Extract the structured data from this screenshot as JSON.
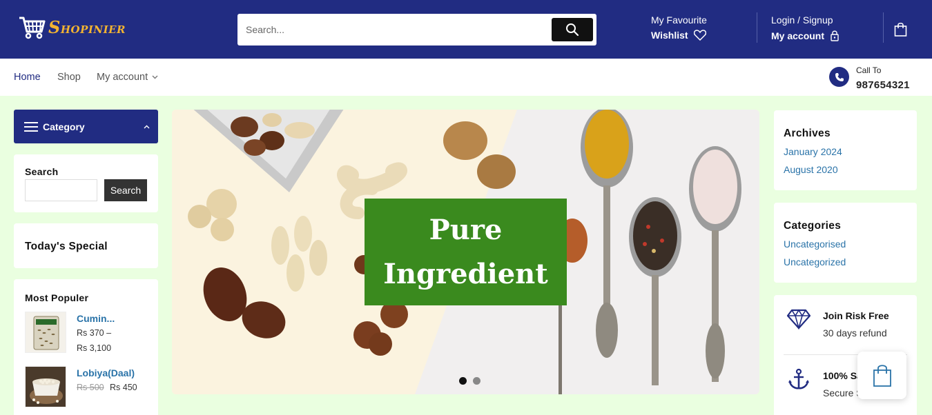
{
  "header": {
    "brand": "SHOPINIER",
    "search_placeholder": "Search...",
    "favourite_small": "My Favourite",
    "favourite_bold": "Wishlist",
    "login_small": "Login / Signup",
    "login_bold": "My account"
  },
  "nav": {
    "items": [
      "Home",
      "Shop",
      "My account"
    ],
    "call_label": "Call To",
    "call_number": "987654321"
  },
  "sidebar_left": {
    "category_label": "Category",
    "search_title": "Search",
    "search_button": "Search",
    "todays_special": "Today's Special",
    "most_popular_title": "Most Populer",
    "products": [
      {
        "name": "Cumin...",
        "price_line1": "Rs 370 –",
        "price_line2": "Rs 3,100"
      },
      {
        "name": "Lobiya(Daal)",
        "old_price": "Rs 500",
        "price": "Rs 450"
      }
    ]
  },
  "hero": {
    "title": "Pure Ingredient",
    "slides": 2,
    "active_slide": 1
  },
  "sidebar_right": {
    "archives_title": "Archives",
    "archives": [
      "January 2024",
      "August 2020"
    ],
    "categories_title": "Categories",
    "categories": [
      "Uncategorised",
      "Uncategorized"
    ],
    "features": [
      {
        "icon": "diamond-icon",
        "title": "Join Risk Free",
        "subtitle": "30 days refund"
      },
      {
        "icon": "anchor-icon",
        "title": "100% Sa",
        "subtitle": "Secure S"
      }
    ]
  },
  "colors": {
    "primary": "#212c82",
    "accent": "#f3b431",
    "hero_box": "#3a8a1e",
    "link": "#2a73a8",
    "page_bg": "#eaffe0"
  }
}
